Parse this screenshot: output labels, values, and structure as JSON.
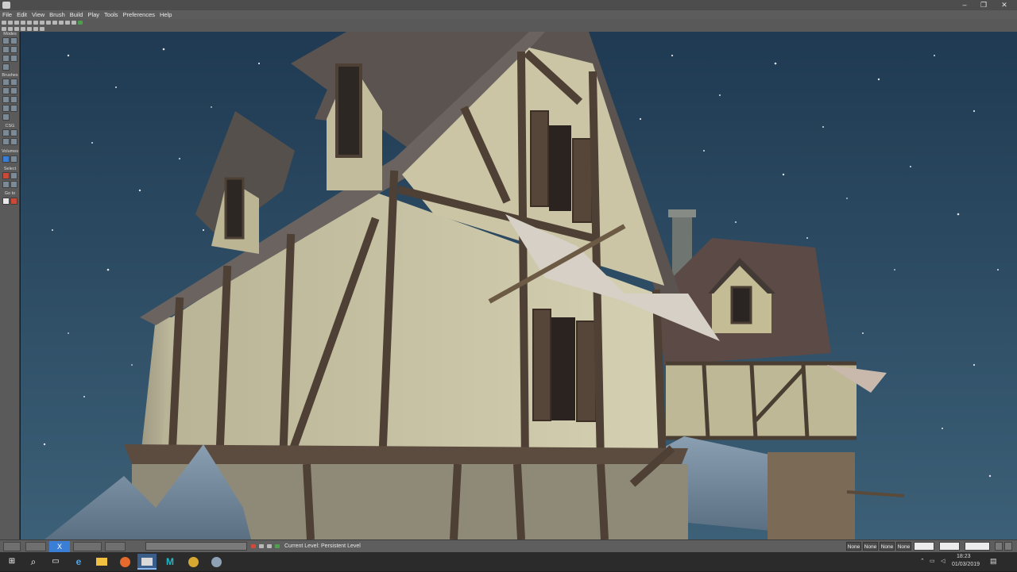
{
  "window": {
    "minimize": "–",
    "maximize": "❐",
    "close": "✕"
  },
  "menu": [
    "File",
    "Edit",
    "View",
    "Brush",
    "Build",
    "Play",
    "Tools",
    "Preferences",
    "Help"
  ],
  "tool_groups": [
    "Modes",
    "Brushes",
    "CSG",
    "Volumes",
    "Select",
    "Go to"
  ],
  "status": {
    "current_level_label": "Current Level:",
    "current_level_value": "Persistent Level",
    "close_tab_label": "X",
    "snap_buttons": [
      "None",
      "None",
      "None",
      "None"
    ]
  },
  "taskbar": {
    "search": "⌕",
    "time": "18:23",
    "date": "01/03/2019"
  },
  "colors": {
    "sky_top": "#1f3a52",
    "sky_bottom": "#3c6077",
    "plaster": "#cbc5a6",
    "timber": "#4e4034",
    "roof": "#5a5350",
    "accent": "#3a7fd5"
  },
  "icons": [
    "app-icon",
    "windows-start-icon",
    "search-icon",
    "task-view-icon",
    "edge-icon",
    "file-explorer-icon",
    "firefox-icon",
    "editor-icon",
    "maya-icon",
    "tool-icon",
    "misc-app-icon"
  ]
}
